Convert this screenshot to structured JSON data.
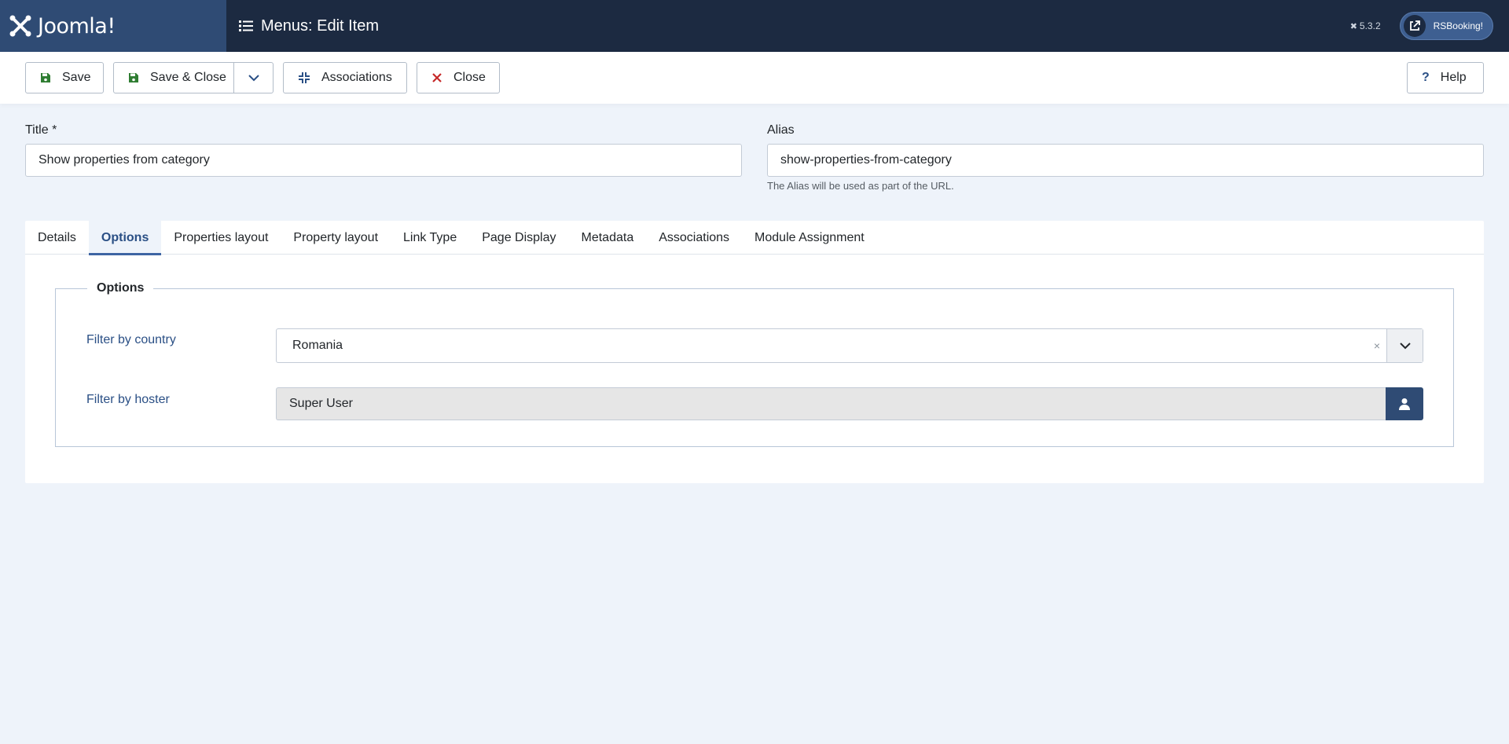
{
  "header": {
    "logo_text": "Joomla!",
    "page_title": "Menus: Edit Item",
    "version": "5.3.2",
    "site_button_label": "RSBooking!"
  },
  "toolbar": {
    "save_label": "Save",
    "save_close_label": "Save & Close",
    "associations_label": "Associations",
    "close_label": "Close",
    "help_label": "Help"
  },
  "form": {
    "title_label": "Title *",
    "title_value": "Show properties from category",
    "alias_label": "Alias",
    "alias_value": "show-properties-from-category",
    "alias_hint": "The Alias will be used as part of the URL."
  },
  "tabs": [
    {
      "label": "Details"
    },
    {
      "label": "Options"
    },
    {
      "label": "Properties layout"
    },
    {
      "label": "Property layout"
    },
    {
      "label": "Link Type"
    },
    {
      "label": "Page Display"
    },
    {
      "label": "Metadata"
    },
    {
      "label": "Associations"
    },
    {
      "label": "Module Assignment"
    }
  ],
  "active_tab": "Options",
  "options": {
    "legend": "Options",
    "country_label": "Filter by country",
    "country_value": "Romania",
    "clear_symbol": "×",
    "hoster_label": "Filter by hoster",
    "hoster_value": "Super User"
  },
  "colors": {
    "header_bg": "#1c2a41",
    "accent": "#2f4b74",
    "save_icon": "#2f7d32",
    "close_icon": "#c62828"
  }
}
